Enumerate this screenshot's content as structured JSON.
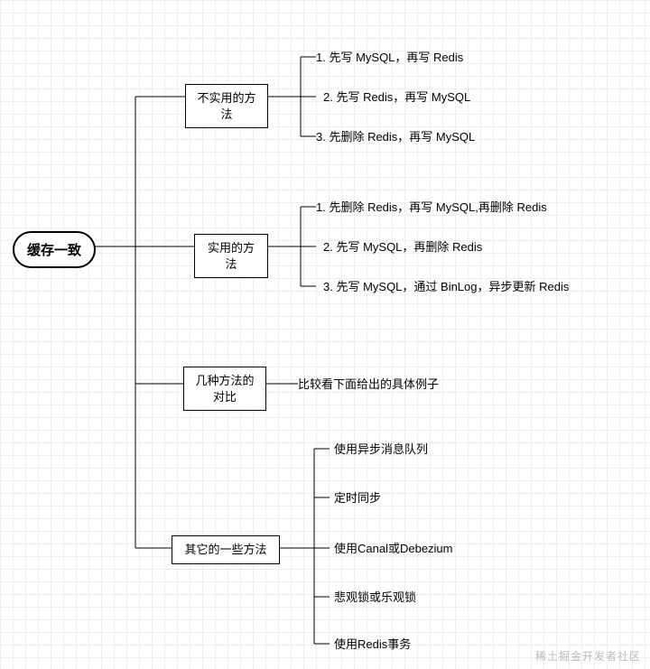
{
  "root": {
    "title": "缓存一致"
  },
  "branches": [
    {
      "title": "不实用的方法",
      "items": [
        "1. 先写 MySQL，再写 Redis",
        "2. 先写 Redis，再写 MySQL",
        "3. 先删除 Redis，再写 MySQL"
      ]
    },
    {
      "title": "实用的方法",
      "items": [
        "1. 先删除 Redis，再写 MySQL,再删除 Redis",
        "2. 先写 MySQL，再删除 Redis",
        "3. 先写 MySQL，通过 BinLog，异步更新 Redis"
      ]
    },
    {
      "title": "几种方法的对比",
      "items": [
        "比较看下面给出的具体例子"
      ]
    },
    {
      "title": "其它的一些方法",
      "items": [
        "使用异步消息队列",
        "定时同步",
        "使用Canal或Debezium",
        "悲观锁或乐观锁",
        "使用Redis事务"
      ]
    }
  ],
  "watermark": "稀土掘金开发者社区"
}
